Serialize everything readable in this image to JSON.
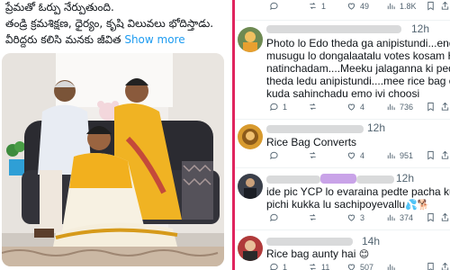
{
  "post": {
    "line1": "ప్రేమతో ఓర్పు నేర్పుతుంది.",
    "line2": "తండ్రి క్రమశిక్షణ, ధైర్యం, కృషి విలువలు భోదిస్తాడు.",
    "line3": "వీరిద్దరు కలిసి మనకు జీవిత",
    "show_more": "Show more"
  },
  "top_actions": {
    "retweets": "1",
    "likes": "49",
    "views": "1.8K"
  },
  "replies": [
    {
      "time": "12h",
      "text_lines": [
        "Photo lo Edo theda ga anipistundi...endukano",
        "musugu lo dongalaatalu votes kosam Hindu la",
        "natinchadam....Meeku jalaganna ki pedda",
        "theda ledu anipistundi....mee rice bag owner",
        "kuda sahinchadu emo ivi choosi"
      ],
      "actions": {
        "replies": "1",
        "retweets": "",
        "likes": "4",
        "views": "736"
      }
    },
    {
      "time": "12h",
      "text_lines": [
        "Rice Bag Converts"
      ],
      "actions": {
        "replies": "",
        "retweets": "",
        "likes": "4",
        "views": "951"
      }
    },
    {
      "time": "12h",
      "text_lines": [
        "ide pic YCP lo evaraina pedte pacha kukka lu",
        "pichi kukka lu sachipoyevallu"
      ],
      "emoji": "💦🐕",
      "actions": {
        "replies": "",
        "retweets": "",
        "likes": "3",
        "views": "374"
      }
    },
    {
      "time": "14h",
      "text_lines": [
        "Rice bag aunty hai"
      ],
      "emoji": "😊",
      "actions": {
        "replies": "1",
        "retweets": "11",
        "likes": "507",
        "views": ""
      }
    }
  ],
  "colors": {
    "divider": "#e0245e",
    "link": "#1d9bf0",
    "muted": "#536471",
    "redacted": "#d9dadb"
  },
  "icons": [
    "reply-icon",
    "retweet-icon",
    "like-icon",
    "views-icon",
    "bookmark-icon",
    "share-icon"
  ]
}
